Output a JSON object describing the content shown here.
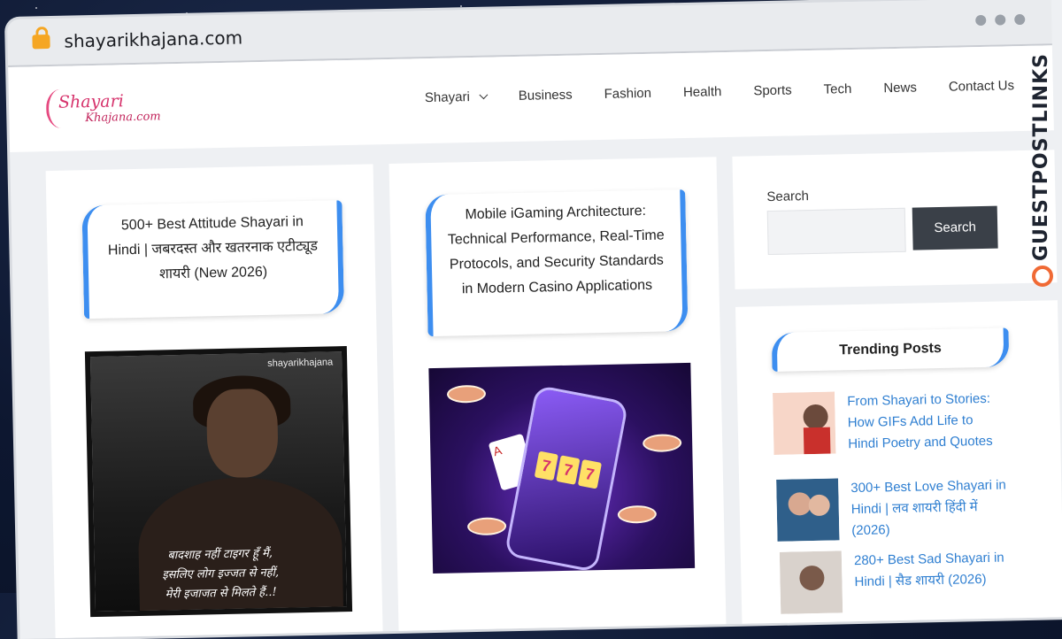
{
  "browser": {
    "url": "shayarikhajana.com"
  },
  "header": {
    "logo_line1": "Shayari",
    "logo_line2": "Khajana.com",
    "nav": [
      "Shayari",
      "Business",
      "Fashion",
      "Health",
      "Sports",
      "Tech",
      "News",
      "Contact Us"
    ]
  },
  "posts": [
    {
      "title": "500+ Best Attitude Shayari in Hindi | जबरदस्त और खतरनाक एटीट्यूड शायरी (New 2026)",
      "watermark": "shayarikhajana",
      "quote": [
        "बादशाह नहीं टाइगर हूँ मैं,",
        "इसलिए लोग इज्जत से नहीं,",
        "मेरी इजाजत से मिलते हैं..!"
      ]
    },
    {
      "title": "Mobile iGaming Architecture: Technical Performance, Real-Time Protocols, and Security Standards in Modern Casino Applications",
      "card_rank": "A",
      "reel_symbol": "7"
    }
  ],
  "sidebar": {
    "search_label": "Search",
    "search_button": "Search",
    "trending_title": "Trending Posts",
    "trending": [
      {
        "title": "From Shayari to Stories: How GIFs Add Life to Hindi Poetry and Quotes"
      },
      {
        "title": "300+ Best Love Shayari in Hindi | लव शायरी हिंदी में (2026)"
      },
      {
        "title": "280+ Best Sad Shayari in Hindi | सैड शायरी (2026)"
      }
    ]
  },
  "watermark": {
    "text": "GUESTPOSTLINKS"
  },
  "colors": {
    "accent": "#3d8ef0",
    "link": "#2f7fd1",
    "button": "#3a4048",
    "brand": "#f06a35"
  }
}
